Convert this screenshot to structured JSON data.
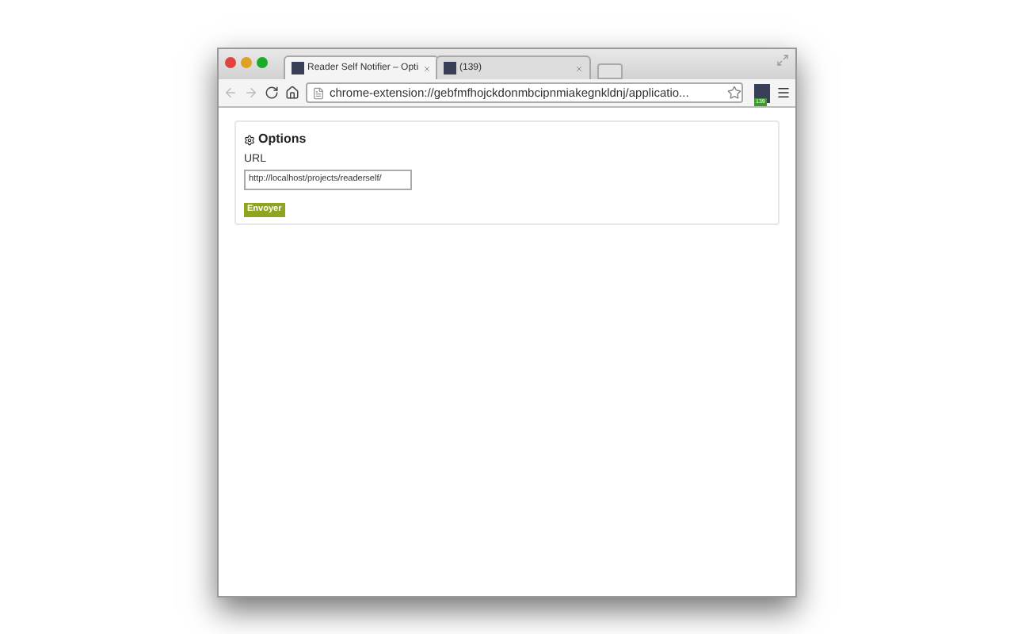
{
  "tabs": [
    {
      "title": "Reader Self Notifier – Opti",
      "selected": true
    },
    {
      "title": "(139)",
      "selected": false
    }
  ],
  "address": "chrome-extension://gebfmfhojckdonmbcipnmiakegnkldnj/applicatio...",
  "extension_badge": "139",
  "options": {
    "heading": "Options",
    "url_label": "URL",
    "url_value": "http://localhost/projects/readerself/",
    "submit": "Envoyer"
  }
}
